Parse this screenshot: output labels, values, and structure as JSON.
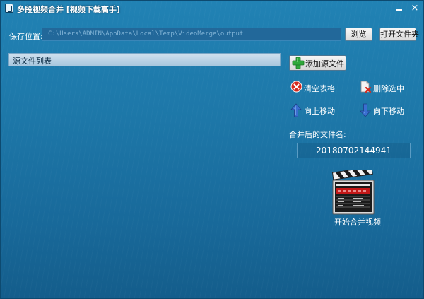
{
  "window": {
    "title": "多段视频合并 [视频下载高手]",
    "minimize_glyph": "",
    "close_glyph": "×"
  },
  "save": {
    "label": "保存位置:",
    "path_value": "C:\\Users\\ADMIN\\AppData\\Local\\Temp\\VideoMerge\\output",
    "browse_label": "浏览",
    "open_folder_label": "打开文件夹"
  },
  "file_list": {
    "header": "源文件列表",
    "items": []
  },
  "actions": {
    "add_label": "添加源文件",
    "clear_label": "清空表格",
    "delete_label": "删除选中",
    "up_label": "向上移动",
    "down_label": "向下移动"
  },
  "merged": {
    "label": "合并后的文件名:",
    "value": "20180702144941"
  },
  "start": {
    "label": "开始合并视频"
  },
  "icons": {
    "app": "app-icon",
    "add": "plus-icon",
    "clear": "clear-icon",
    "delete": "delete-icon",
    "up": "arrow-up-icon",
    "down": "arrow-down-icon",
    "start": "clapperboard-icon"
  },
  "colors": {
    "background": "#1d77a8",
    "plus": "#2fa83a",
    "clear": "#d42a1e",
    "arrow": "#3a6fd0",
    "field_border": "#5a9cc4"
  }
}
